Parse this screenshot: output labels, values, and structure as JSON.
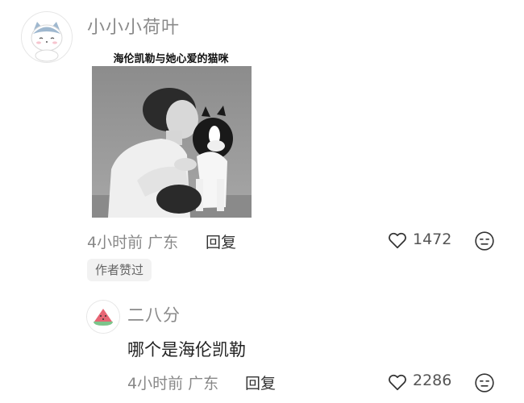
{
  "comment": {
    "username": "小小小荷叶",
    "avatar_icon": "cat-avatar-icon",
    "image_caption": "海伦凯勒与她心爱的猫咪",
    "time_location": "4小时前 广东",
    "reply_label": "回复",
    "like_count": "1472",
    "badge": "作者赞过"
  },
  "reply": {
    "username": "二八分",
    "avatar_icon": "watermelon-avatar-icon",
    "text": "哪个是海伦凯勒",
    "time_location": "4小时前 广东",
    "reply_label": "回复",
    "like_count": "2286"
  },
  "colors": {
    "muted_text": "#8a8a8a",
    "badge_bg": "#f2f2f2"
  }
}
